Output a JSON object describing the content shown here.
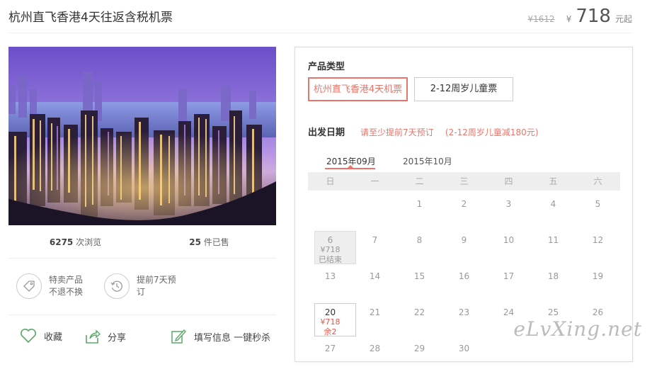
{
  "header": {
    "title": "杭州直飞香港4天往返含税机票",
    "orig_price": "¥1612",
    "cur_symbol": "¥",
    "cur_price": "718",
    "price_suffix": "元起"
  },
  "stats": {
    "views_num": "6275",
    "views_label": "次浏览",
    "sold_num": "25",
    "sold_label": "件已售"
  },
  "features": [
    {
      "icon": "tag-icon",
      "line1": "特卖产品",
      "line2": "不退不换"
    },
    {
      "icon": "clock-history-icon",
      "line1": "提前7天预",
      "line2": "订"
    }
  ],
  "actions": [
    {
      "icon": "heart-icon",
      "label": "收藏"
    },
    {
      "icon": "share-icon",
      "label": "分享"
    },
    {
      "icon": "edit-icon",
      "label": "填写信息 一键秒杀"
    }
  ],
  "booking": {
    "product_type_label": "产品类型",
    "product_types": [
      "杭州直飞香港4天机票",
      "2-12周岁儿童票"
    ],
    "departure_label": "出发日期",
    "notice1": "请至少提前7天预订",
    "notice2": "(2-12周岁儿童减180元)",
    "months": [
      "2015年09月",
      "2015年10月"
    ],
    "weekdays": [
      "日",
      "一",
      "二",
      "三",
      "四",
      "五",
      "六"
    ],
    "days": [
      {
        "d": ""
      },
      {
        "d": ""
      },
      {
        "d": "1"
      },
      {
        "d": "2"
      },
      {
        "d": "3"
      },
      {
        "d": "4"
      },
      {
        "d": "5"
      },
      {
        "d": "6",
        "price": "¥718",
        "status": "已结束",
        "state": "ended"
      },
      {
        "d": "7"
      },
      {
        "d": "8"
      },
      {
        "d": "9"
      },
      {
        "d": "10"
      },
      {
        "d": "11"
      },
      {
        "d": "12"
      },
      {
        "d": "13"
      },
      {
        "d": "14"
      },
      {
        "d": "15"
      },
      {
        "d": "16"
      },
      {
        "d": "17"
      },
      {
        "d": "18"
      },
      {
        "d": "19"
      },
      {
        "d": "20",
        "price": "¥718",
        "status": "余2",
        "state": "avail"
      },
      {
        "d": "21"
      },
      {
        "d": "22"
      },
      {
        "d": "23"
      },
      {
        "d": "24"
      },
      {
        "d": "25"
      },
      {
        "d": "26"
      },
      {
        "d": "27"
      },
      {
        "d": "28"
      },
      {
        "d": "29"
      },
      {
        "d": "30"
      }
    ]
  },
  "watermark": "eLvXing.net",
  "colors": {
    "accent": "#e8756a",
    "price_red": "#e8564a"
  }
}
